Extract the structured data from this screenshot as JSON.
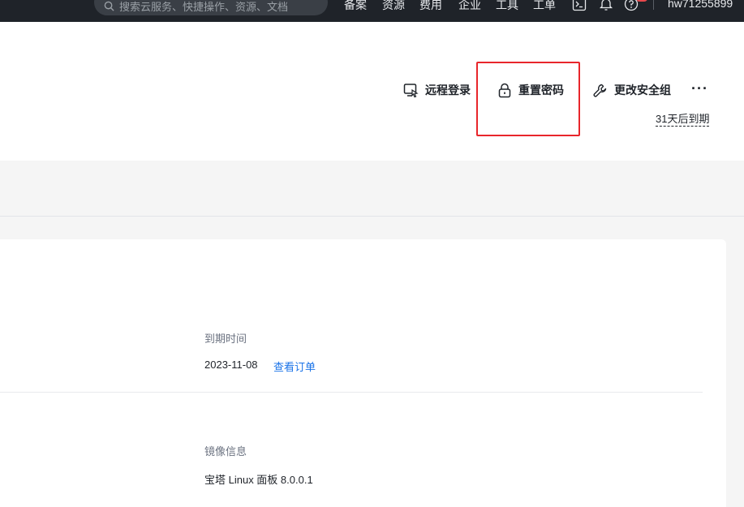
{
  "topbar": {
    "search_placeholder": "搜索云服务、快捷操作、资源、文档",
    "nav": [
      "备案",
      "资源",
      "费用",
      "企业",
      "工具",
      "工单"
    ],
    "user": "hw71255899"
  },
  "actions": {
    "remote_login": "远程登录",
    "reset_password": "重置密码",
    "change_security_group": "更改安全组",
    "more": "···"
  },
  "expire_notice": "31天后到期",
  "details": {
    "expire_label": "到期时间",
    "expire_value": "2023-11-08",
    "view_order": "查看订单",
    "image_label": "镜像信息",
    "image_value": "宝塔 Linux 面板 8.0.0.1"
  },
  "colors": {
    "topbar_bg": "#1f2329",
    "highlight": "#e8262b",
    "link": "#1a73e8"
  }
}
